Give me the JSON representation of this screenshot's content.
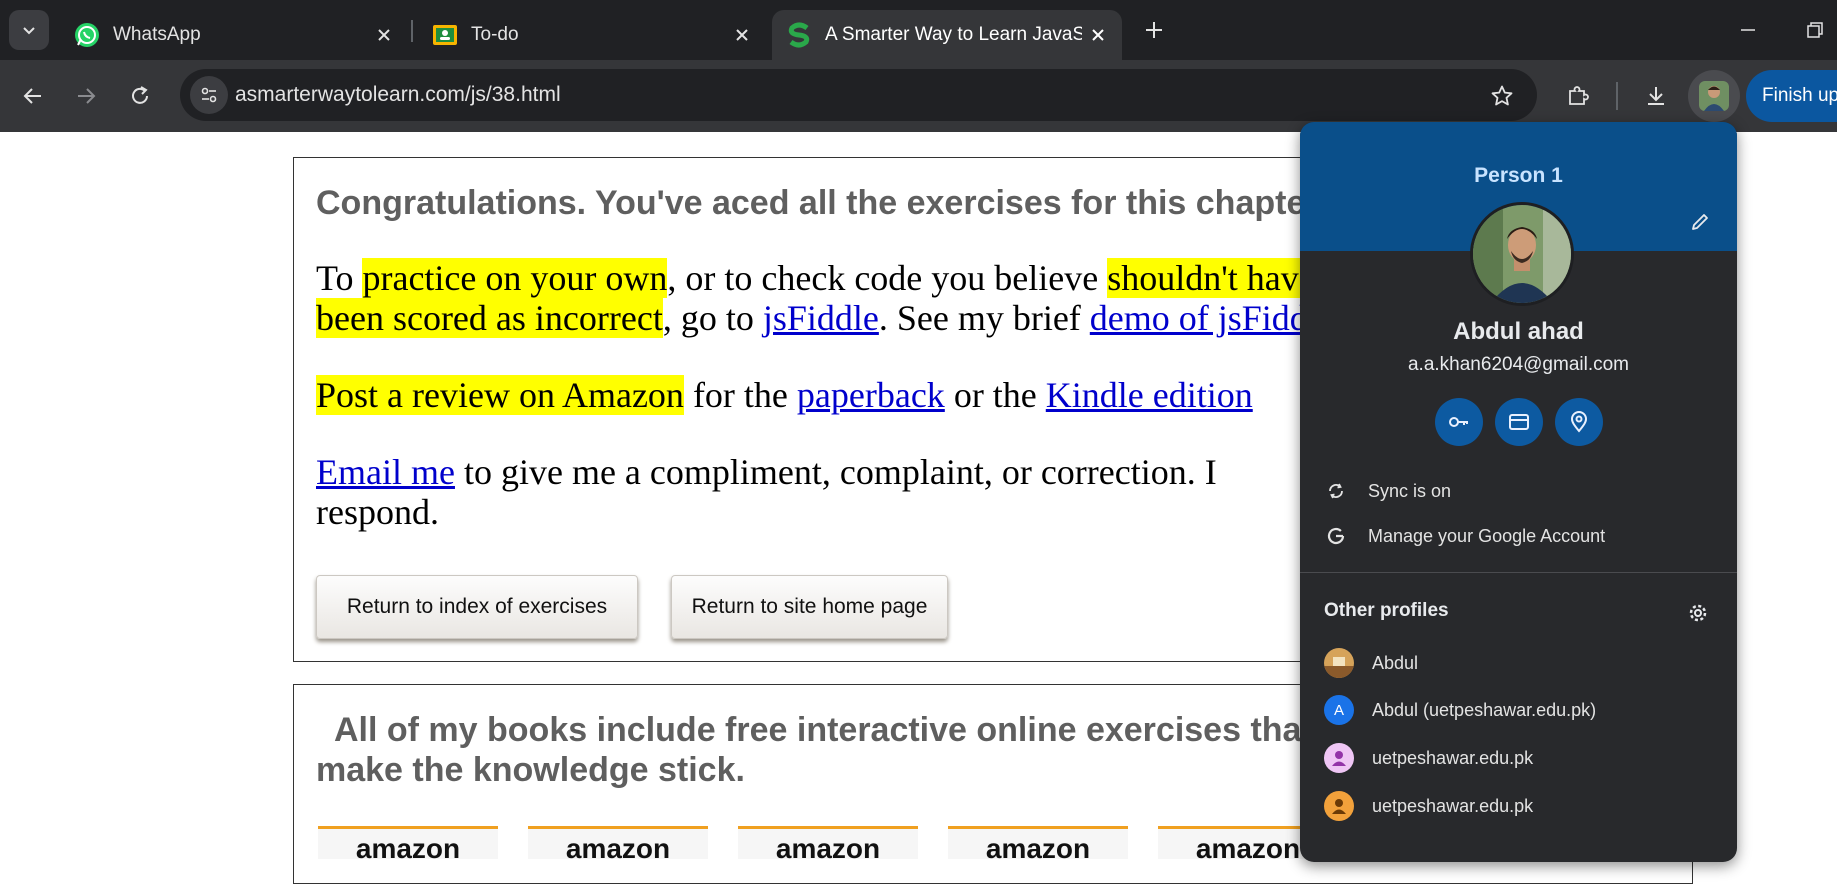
{
  "tabs": [
    {
      "title": "WhatsApp",
      "icon": "whatsapp-icon"
    },
    {
      "title": "To-do",
      "icon": "google-classroom-icon"
    },
    {
      "title": "A Smarter Way to Learn JavaScript",
      "icon": "smarter-way-icon",
      "active": true
    }
  ],
  "address": {
    "url": "asmarterwaytolearn.com/js/38.html"
  },
  "toolbar": {
    "finish_update_label": "Finish update"
  },
  "page": {
    "congrats": "Congratulations. You've aced all the exercises for this chapter.",
    "p1": {
      "t1": "To ",
      "h1": "practice on your own",
      "t2": ", or to check code you believe ",
      "h2": "shouldn't have",
      "h3": "been scored as incorrect",
      "t3": ", go to ",
      "l1": "jsFiddle",
      "t4": ". See my brief ",
      "l2": "demo of jsFiddle"
    },
    "p2": {
      "h1": "Post a review on Amazon",
      "t1": " for the ",
      "l1": "paperback",
      "t2": " or the ",
      "l2": "Kindle edition"
    },
    "p3": {
      "l1": "Email me",
      "t1": " to give me a compliment, complaint, or correction. I",
      "t2": "respond."
    },
    "btn_index": "Return to index of exercises",
    "btn_home": "Return to site home page",
    "books_line1": "All of my books include free interactive online exercises that",
    "books_line2": "make the knowledge stick.",
    "amazon_label": "amazon"
  },
  "profile": {
    "header_name": "Person 1",
    "full_name": "Abdul ahad",
    "email": "a.a.khan6204@gmail.com",
    "sync_label": "Sync is on",
    "manage_label": "Manage your Google Account",
    "other_profiles_label": "Other profiles",
    "other_profiles": [
      {
        "name": "Abdul",
        "initial": ""
      },
      {
        "name": "Abdul (uetpeshawar.edu.pk)",
        "initial": "A"
      },
      {
        "name": "uetpeshawar.edu.pk",
        "initial": ""
      },
      {
        "name": "uetpeshawar.edu.pk",
        "initial": ""
      }
    ]
  },
  "colors": {
    "highlight": "#ffff00",
    "link": "#0000cc",
    "accent_blue": "#0b57a0",
    "profile_banner": "#0a4f8a"
  }
}
